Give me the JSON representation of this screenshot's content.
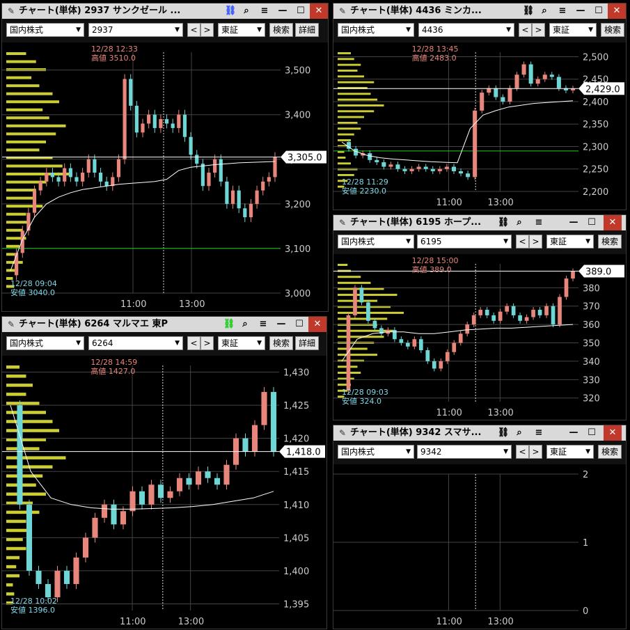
{
  "common": {
    "market": "国内株式",
    "exchange": "東証",
    "search": "検索",
    "detail": "詳細",
    "nav_prev": "<",
    "nav_next": ">",
    "minimize": "—",
    "maximize": "☐",
    "close": "✕"
  },
  "colors": {
    "up": "#e8867b",
    "down": "#6fd6d6",
    "vwap": "#ffffff",
    "volume_profile": "#cccc33",
    "green_line": "#22cc22",
    "grid": "#444444",
    "tick": "#cccccc",
    "high_label": "#e8867b",
    "low_label": "#80d8e8"
  },
  "windows": [
    {
      "title": "チャート(単体) 2937 サンクゼール ...",
      "code": "2937",
      "link_badge": "2",
      "link_color": "#3355ff",
      "has_detail": true,
      "time_labels": [
        "11:00",
        "13:00"
      ],
      "chart_data": {
        "type": "candlestick",
        "ylim": [
          3000,
          3540
        ],
        "yticks": [
          3000,
          3100,
          3200,
          3300,
          3400,
          3500
        ],
        "ytick_labels": [
          "3,000",
          "3,100",
          "3,200",
          "3,300",
          "3,400",
          "3,500"
        ],
        "last_price": 3305,
        "last_label": "3,305.0",
        "green_line": 3100,
        "high": {
          "time": "12/28 12:33",
          "label": "高値",
          "value": "3510.0"
        },
        "low": {
          "time": "12/28 09:04",
          "label": "安値",
          "value": "3040.0"
        },
        "price_path": [
          3040,
          3090,
          3140,
          3180,
          3230,
          3250,
          3270,
          3260,
          3250,
          3280,
          3260,
          3250,
          3270,
          3300,
          3270,
          3250,
          3240,
          3260,
          3300,
          3480,
          3420,
          3360,
          3380,
          3400,
          3370,
          3390,
          3380,
          3370,
          3400,
          3350,
          3310,
          3290,
          3240,
          3270,
          3300,
          3250,
          3200,
          3230,
          3190,
          3170,
          3200,
          3230,
          3250,
          3260,
          3305
        ],
        "vwap_path": [
          3050,
          3120,
          3170,
          3200,
          3215,
          3225,
          3232,
          3236,
          3240,
          3244,
          3246,
          3248,
          3250,
          3255,
          3275,
          3282,
          3285,
          3288,
          3290,
          3292,
          3293,
          3294,
          3295
        ],
        "volume_profile": [
          0.3,
          0.45,
          0.6,
          0.38,
          0.5,
          0.7,
          0.8,
          0.55,
          0.65,
          0.9,
          0.75,
          0.6,
          0.5,
          0.7,
          0.85,
          1.0,
          0.6,
          0.45,
          0.4,
          0.55,
          0.3,
          0.35,
          0.25,
          0.3,
          0.2,
          0.15,
          0.25,
          0.18,
          0.1,
          0.12
        ]
      }
    },
    {
      "title": "チャート(単体) 4436 ミンカ...",
      "code": "4436",
      "link_badge": "",
      "link_color": "#555555",
      "has_detail": false,
      "time_labels": [
        "11:00",
        "13:00"
      ],
      "chart_data": {
        "type": "candlestick",
        "ylim": [
          2200,
          2510
        ],
        "yticks": [
          2200,
          2250,
          2300,
          2350,
          2400,
          2450,
          2500
        ],
        "ytick_labels": [
          "2,200",
          "2,250",
          "2,300",
          "2,350",
          "2,400",
          "2,450",
          "2,500"
        ],
        "last_price": 2429,
        "last_label": "2,429.0",
        "green_line": 2290,
        "high": {
          "time": "12/28 13:45",
          "label": "高値",
          "value": "2483.0"
        },
        "low": {
          "time": "12/28 11:29",
          "label": "安値",
          "value": "2230.0"
        },
        "price_path": [
          2310,
          2295,
          2280,
          2285,
          2270,
          2265,
          2255,
          2260,
          2250,
          2245,
          2250,
          2255,
          2250,
          2245,
          2250,
          2255,
          2245,
          2240,
          2232,
          2380,
          2420,
          2430,
          2410,
          2400,
          2430,
          2460,
          2483,
          2440,
          2450,
          2460,
          2455,
          2430,
          2425,
          2429
        ],
        "vwap_path": [
          2310,
          2290,
          2280,
          2275,
          2272,
          2270,
          2268,
          2266,
          2265,
          2264,
          2340,
          2370,
          2380,
          2388,
          2392,
          2396,
          2398,
          2400,
          2402
        ],
        "volume_profile": [
          0.2,
          0.25,
          0.35,
          0.3,
          0.4,
          0.55,
          0.45,
          0.5,
          0.6,
          0.7,
          0.55,
          0.4,
          0.3,
          0.35,
          0.25,
          0.2,
          0.15,
          0.1,
          0.12,
          0.2,
          0.3,
          0.25,
          0.15,
          0.1
        ]
      }
    },
    {
      "title": "チャート(単体) 6264 マルマエ 東P",
      "code": "6264",
      "link_badge": "3",
      "link_color": "#22cc22",
      "has_detail": true,
      "time_labels": [
        "11:00",
        "13:00"
      ],
      "chart_data": {
        "type": "candlestick",
        "ylim": [
          1394,
          1431
        ],
        "yticks": [
          1395,
          1400,
          1405,
          1410,
          1415,
          1420,
          1425,
          1430
        ],
        "ytick_labels": [
          "1,395",
          "1,400",
          "1,405",
          "1,410",
          "1,415",
          "1,420",
          "1,425",
          "1,430"
        ],
        "last_price": 1418,
        "last_label": "1,418.0",
        "green_line": null,
        "high": {
          "time": "12/28 14:59",
          "label": "高値",
          "value": "1427.0"
        },
        "low": {
          "time": "12/28 10:02",
          "label": "安値",
          "value": "1396.0"
        },
        "price_path": [
          1425,
          1410,
          1400,
          1398,
          1396,
          1400,
          1398,
          1402,
          1405,
          1408,
          1410,
          1407,
          1409,
          1412,
          1410,
          1413,
          1411,
          1412,
          1414,
          1413,
          1415,
          1414,
          1413,
          1416,
          1420,
          1418,
          1422,
          1427,
          1418
        ],
        "vwap_path": [
          1425,
          1415,
          1411,
          1410,
          1409.5,
          1409.3,
          1409.3,
          1409.4,
          1409.5,
          1409.7,
          1410,
          1410.5,
          1411,
          1412
        ],
        "volume_profile": [
          0.2,
          0.3,
          0.4,
          0.3,
          0.5,
          0.6,
          0.7,
          0.8,
          0.6,
          0.5,
          0.9,
          0.7,
          0.55,
          0.45,
          0.6,
          0.4,
          0.5,
          0.3,
          0.35,
          0.25,
          0.3,
          0.2,
          0.15,
          0.2,
          0.1,
          0.12,
          0.1
        ]
      }
    },
    {
      "title": "チャート(単体) 6195 ホープ...",
      "code": "6195",
      "link_badge": "",
      "link_color": "#555555",
      "has_detail": false,
      "time_labels": [
        "11:00",
        "13:00"
      ],
      "chart_data": {
        "type": "candlestick",
        "ylim": [
          318,
          393
        ],
        "yticks": [
          320,
          330,
          340,
          350,
          360,
          370,
          380
        ],
        "ytick_labels": [
          "320",
          "330",
          "340",
          "350",
          "360",
          "370",
          "380"
        ],
        "last_price": 389,
        "last_label": "389.0",
        "green_line": null,
        "high": {
          "time": "12/28 15:00",
          "label": "高値",
          "value": "389.0"
        },
        "low": {
          "time": "12/28 09:03",
          "label": "安値",
          "value": "324.0"
        },
        "price_path": [
          324,
          365,
          380,
          372,
          362,
          358,
          355,
          357,
          352,
          350,
          348,
          352,
          346,
          340,
          336,
          340,
          345,
          350,
          355,
          360,
          365,
          368,
          365,
          362,
          367,
          370,
          365,
          362,
          364,
          368,
          365,
          370,
          360,
          375,
          385,
          389
        ],
        "vwap_path": [
          340,
          352,
          355,
          356,
          356,
          355,
          355,
          356,
          357,
          357.5,
          358,
          358,
          358.5,
          359,
          359.5,
          360
        ],
        "volume_profile": [
          0.15,
          0.2,
          0.35,
          0.5,
          0.7,
          0.9,
          0.6,
          0.8,
          1.0,
          0.75,
          0.6,
          0.85,
          0.7,
          0.55,
          0.45,
          0.6,
          0.4,
          0.3,
          0.35,
          0.25,
          0.2,
          0.15,
          0.1
        ]
      }
    },
    {
      "title": "チャート(単体) 9342 スマサ...",
      "code": "9342",
      "link_badge": "",
      "link_color": "#555555",
      "has_detail": false,
      "time_labels": [
        "11:00",
        "13:00"
      ],
      "chart_data": {
        "type": "candlestick",
        "ylim": [
          0,
          2
        ],
        "yticks": [
          0,
          1,
          2
        ],
        "ytick_labels": [
          "0",
          "1",
          "2"
        ],
        "last_price": null,
        "last_label": "",
        "green_line": null,
        "high": null,
        "low": null,
        "price_path": [],
        "vwap_path": [],
        "volume_profile": []
      }
    }
  ]
}
